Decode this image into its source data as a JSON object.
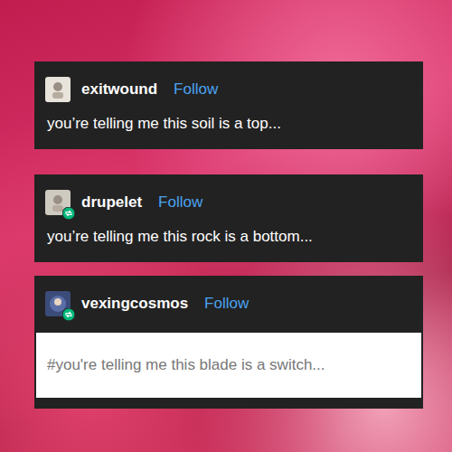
{
  "posts": [
    {
      "username": "exitwound",
      "follow": "Follow",
      "reblogged": false,
      "kind": "body",
      "text": "you’re telling me this soil is a top..."
    },
    {
      "username": "drupelet",
      "follow": "Follow",
      "reblogged": true,
      "kind": "body",
      "text": "you’re telling me this rock is a bottom..."
    },
    {
      "username": "vexingcosmos",
      "follow": "Follow",
      "reblogged": true,
      "kind": "tags",
      "text": "#you're telling me this blade is a switch..."
    }
  ]
}
